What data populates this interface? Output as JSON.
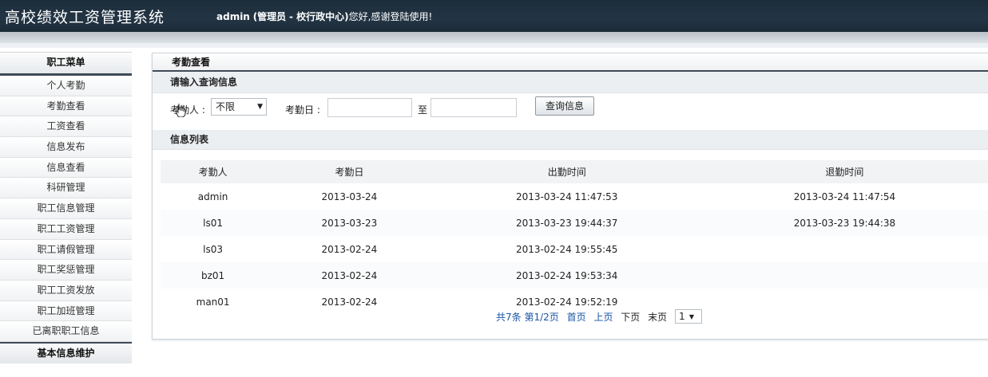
{
  "header": {
    "app_title": "高校绩效工资管理系统",
    "user": "admin",
    "role": "(管理员",
    "dept": "- 校行政中心)",
    "greeting": "您好,感谢登陆使用!"
  },
  "sidebar": {
    "heading": "职工菜单",
    "items": [
      "个人考勤",
      "考勤查看",
      "工资查看",
      "信息发布",
      "信息查看",
      "科研管理",
      "职工信息管理",
      "职工工资管理",
      "职工请假管理",
      "职工奖惩管理",
      "职工工资发放",
      "职工加班管理",
      "已离职职工信息"
    ],
    "footer": "基本信息维护"
  },
  "panel": {
    "title": "考勤查看",
    "query_section": "请输入查询信息",
    "person_label": "考勤人 :",
    "person_value": "不限",
    "date_label": "考勤日 :",
    "date_from": "",
    "date_to_label": "至",
    "date_to": "",
    "search_button": "查询信息",
    "list_section": "信息列表"
  },
  "table": {
    "columns": [
      "考勤人",
      "考勤日",
      "出勤时间",
      "退勤时间"
    ],
    "rows": [
      [
        "admin",
        "2013-03-24",
        "2013-03-24 11:47:53",
        "2013-03-24 11:47:54"
      ],
      [
        "ls01",
        "2013-03-23",
        "2013-03-23 19:44:37",
        "2013-03-23 19:44:38"
      ],
      [
        "ls03",
        "2013-02-24",
        "2013-02-24 19:55:45",
        ""
      ],
      [
        "bz01",
        "2013-02-24",
        "2013-02-24 19:53:34",
        ""
      ],
      [
        "man01",
        "2013-02-24",
        "2013-02-24 19:52:19",
        ""
      ]
    ]
  },
  "pager": {
    "summary": "共7条 第1/2页",
    "first": "首页",
    "prev": "上页",
    "next": "下页",
    "last": "末页",
    "page_value": "1"
  },
  "colors": {
    "header_bg": "#233545",
    "link": "#1a55a5",
    "accent_bar": "#3f4a55"
  }
}
